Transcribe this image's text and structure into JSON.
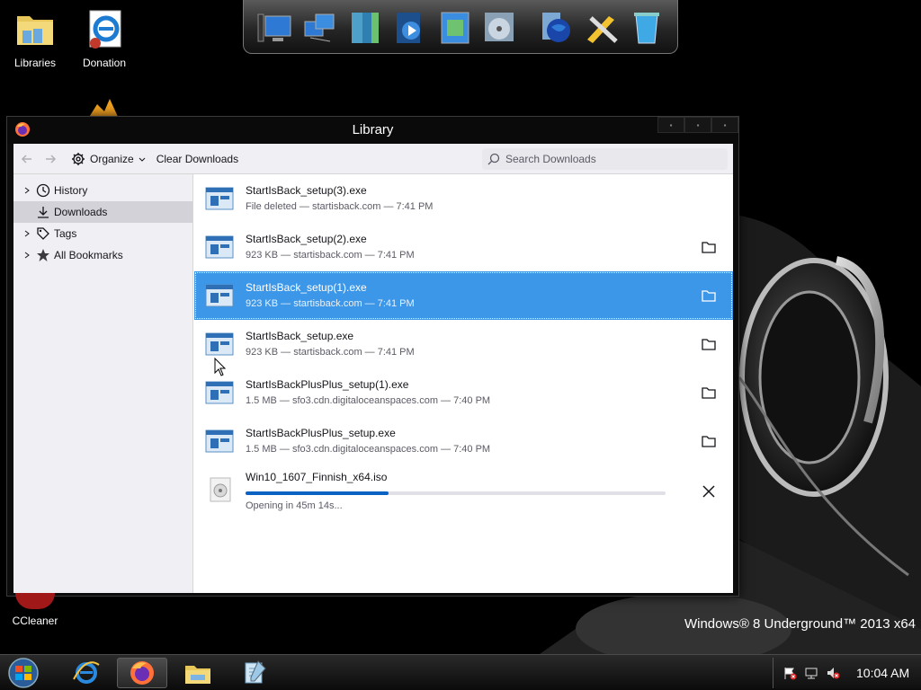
{
  "desktop": {
    "icons": [
      {
        "label": "Libraries"
      },
      {
        "label": "Donation"
      },
      {
        "label": "CCleaner"
      }
    ],
    "brand_text": "Windows® 8 Underground™ 2013 x64"
  },
  "dock": {
    "items": [
      "computer-icon",
      "network-icon",
      "documents-icon",
      "media-player-icon",
      "control-panel-icon",
      "disc-icon",
      "globe-icon",
      "tools-icon",
      "recycle-bin-icon"
    ]
  },
  "window": {
    "title": "Library",
    "toolbar": {
      "organize_label": "Organize",
      "clear_label": "Clear Downloads",
      "search_placeholder": "Search Downloads"
    },
    "sidebar": {
      "items": [
        {
          "label": "History",
          "icon": "clock-icon"
        },
        {
          "label": "Downloads",
          "icon": "download-icon"
        },
        {
          "label": "Tags",
          "icon": "tag-icon"
        },
        {
          "label": "All Bookmarks",
          "icon": "star-icon"
        }
      ]
    },
    "downloads": [
      {
        "name": "StartIsBack_setup(3).exe",
        "meta": "File deleted — startisback.com — 7:41 PM"
      },
      {
        "name": "StartIsBack_setup(2).exe",
        "meta": "923 KB — startisback.com — 7:41 PM"
      },
      {
        "name": "StartIsBack_setup(1).exe",
        "meta": "923 KB — startisback.com — 7:41 PM"
      },
      {
        "name": "StartIsBack_setup.exe",
        "meta": "923 KB — startisback.com — 7:41 PM"
      },
      {
        "name": "StartIsBackPlusPlus_setup(1).exe",
        "meta": "1.5 MB — sfo3.cdn.digitaloceanspaces.com — 7:40 PM"
      },
      {
        "name": "StartIsBackPlusPlus_setup.exe",
        "meta": "1.5 MB — sfo3.cdn.digitaloceanspaces.com — 7:40 PM"
      },
      {
        "name": "Win10_1607_Finnish_x64.iso",
        "meta": "Opening in 45m 14s...",
        "progress": 0.34
      }
    ]
  },
  "taskbar": {
    "clock": "10:04 AM"
  },
  "colors": {
    "selection": "#3d97e9",
    "progress": "#0a62c3"
  }
}
